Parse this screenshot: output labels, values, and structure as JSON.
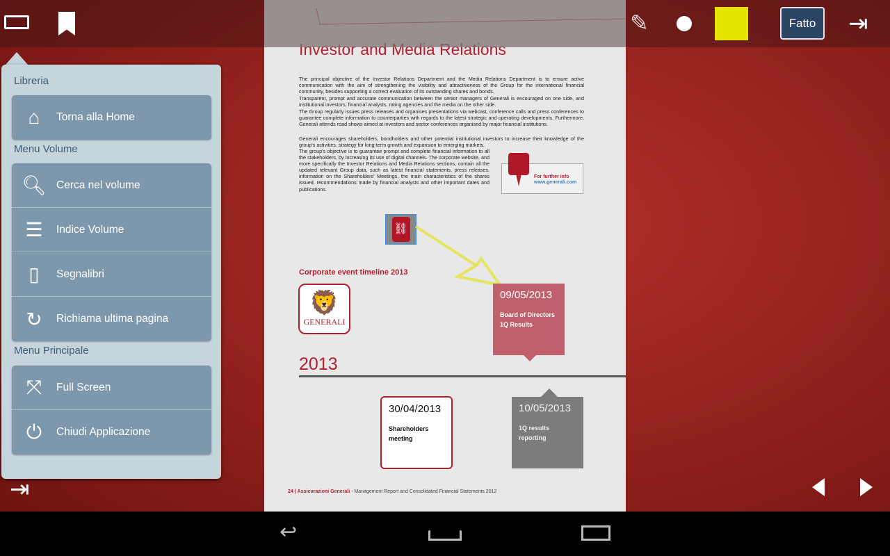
{
  "toolbar": {
    "done_label": "Fatto",
    "highlight_color": "#e5e500"
  },
  "document": {
    "title": "Investor and Media Relations",
    "paragraphs": [
      "The principal objective of the Investor Relations Department and the Media Relations Department is to ensure active communication with the aim of strengthening the visibility and attractiveness of the Group for the international financial community, besides supporting a correct evaluation of its outstanding shares and bonds.",
      "Transparent, prompt and accurate communication between the senior managers of Generali is encouraged on one side, and institutional investors, financial analysts, rating agencies and the media on the other side.",
      "The Group regularly issues press releases and organises presentations via webcast, conference calls and press conferences to guarantee complete information to counterparties with regards to the latest strategic and operating developments. Furthermore, Generali attends road shows aimed at investors and sector conferences organised by major financial institutions.",
      "Generali encourages shareholders, bondholders and other potential institutional investors to increase their knowledge of the group's activities, strategy for long-term growth and expansion to emerging markets.",
      "The group's objective is to guarantee prompt and complete financial information to all the stakeholders, by increasing its use of digital channels. The corporate website, and more specifically the Investor Relations and Media Relations sections, contain all the updated relevant Group data, such as latest financial statements, press releases, information on the Shareholders' Meetings, the main characteristics of the shares issued, recommendations made by financial analysts and other important dates and publications."
    ],
    "info_title": "For further info",
    "info_url": "www.generali.com",
    "timeline_title": "Corporate event timeline 2013",
    "logo_text": "GENERALI",
    "year": "2013",
    "events": [
      {
        "date": "09/05/2013",
        "text": "Board of Directors 1Q Results"
      },
      {
        "date": "30/04/2013",
        "text": "Shareholders meeting"
      },
      {
        "date": "10/05/2013",
        "text": "1Q results reporting"
      }
    ],
    "footer": {
      "page": "24",
      "company": "Assicurazioni Generali",
      "rest": " - Management Report and Consolidated Financial Statements 2012"
    }
  },
  "menu": {
    "sections": [
      {
        "label": "Libreria",
        "items": [
          {
            "label": "Torna alla Home",
            "icon": "home-icon"
          }
        ]
      },
      {
        "label": "Menu Volume",
        "items": [
          {
            "label": "Cerca nel volume",
            "icon": "search-icon"
          },
          {
            "label": "Indice Volume",
            "icon": "list-icon"
          },
          {
            "label": "Segnalibri",
            "icon": "notebook-icon"
          },
          {
            "label": "Richiama ultima pagina",
            "icon": "refresh-icon"
          }
        ]
      },
      {
        "label": "Menu Principale",
        "items": [
          {
            "label": "Full Screen",
            "icon": "fullscreen-icon"
          },
          {
            "label": "Chiudi Applicazione",
            "icon": "power-icon"
          }
        ]
      }
    ]
  }
}
